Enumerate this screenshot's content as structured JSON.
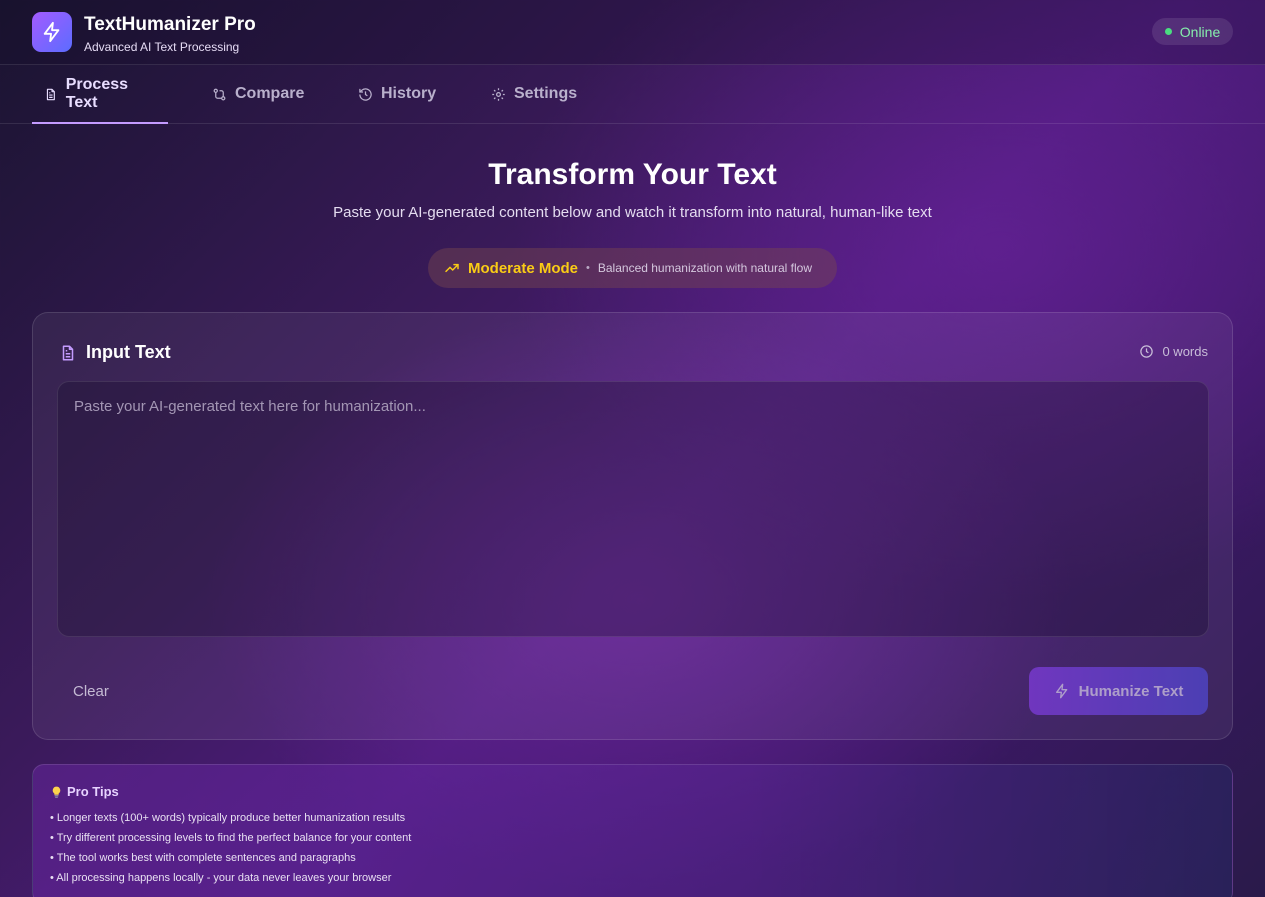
{
  "app": {
    "title": "TextHumanizer Pro",
    "subtitle": "Advanced AI Text Processing",
    "status": "Online",
    "logo_icon": "lightning-icon"
  },
  "tabs": [
    {
      "label": "Process Text",
      "icon": "document-icon",
      "active": true
    },
    {
      "label": "Compare",
      "icon": "git-compare-icon",
      "active": false
    },
    {
      "label": "History",
      "icon": "history-icon",
      "active": false
    },
    {
      "label": "Settings",
      "icon": "gear-icon",
      "active": false
    }
  ],
  "hero": {
    "title": "Transform Your Text",
    "subtitle": "Paste your AI-generated content below and watch it transform into natural, human-like text"
  },
  "mode": {
    "label": "Moderate Mode",
    "separator": "•",
    "description": "Balanced humanization with natural flow",
    "icon": "trending-up-icon"
  },
  "input": {
    "title": "Input Text",
    "word_count": "0 words",
    "value": "",
    "placeholder": "Paste your AI-generated text here for humanization...",
    "clear_label": "Clear",
    "submit_label": "Humanize Text"
  },
  "tips": {
    "title": "Pro Tips",
    "items": [
      "• Longer texts (100+ words) typically produce better humanization results",
      "• Try different processing levels to find the perfect balance for your content",
      "• The tool works best with complete sentences and paragraphs",
      "• All processing happens locally - your data never leaves your browser"
    ]
  },
  "colors": {
    "accent": "#c49bff",
    "mode": "#facc15",
    "status": "#4ade80"
  }
}
